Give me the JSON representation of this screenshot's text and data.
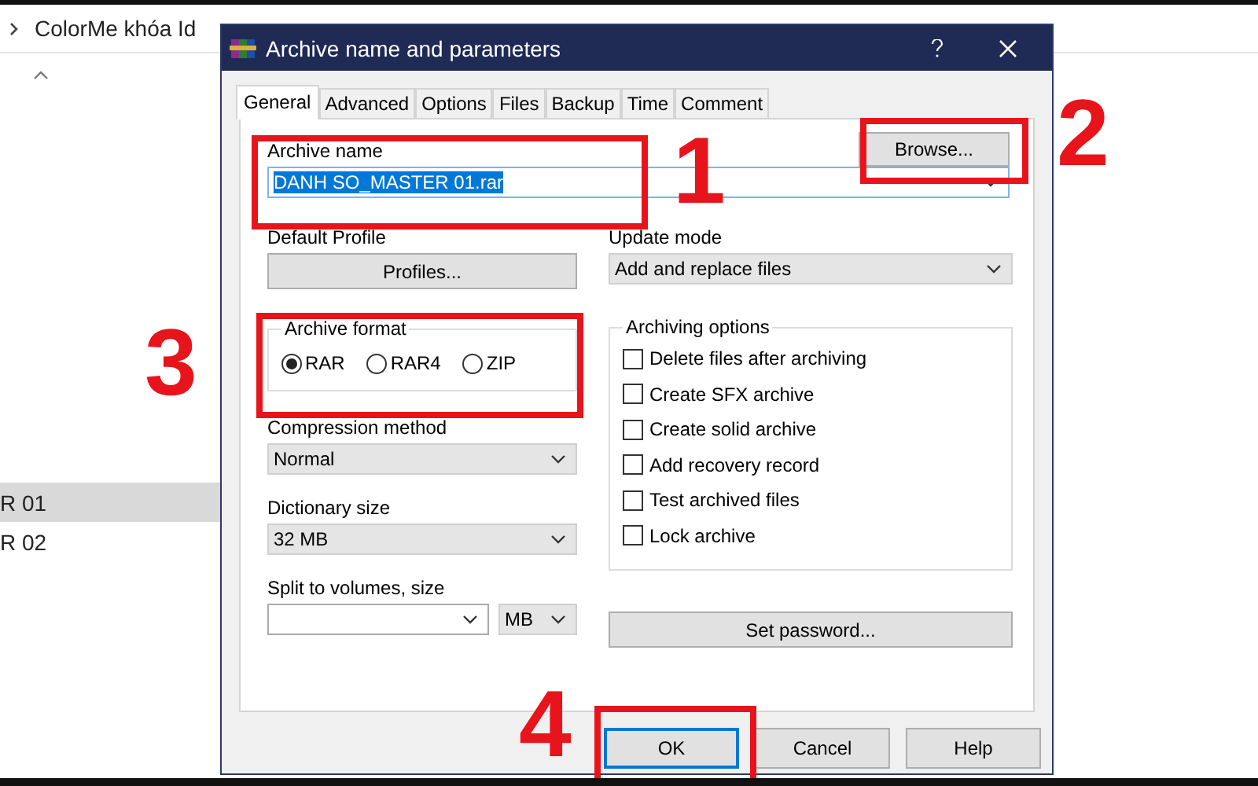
{
  "explorer": {
    "breadcrumb": "ColorMe khóa Id",
    "rows": [
      {
        "label": "R 01",
        "selected": true
      },
      {
        "label": "R 02",
        "selected": false
      }
    ]
  },
  "dialog": {
    "title": "Archive name and parameters",
    "tabs": [
      {
        "label": "General",
        "selected": true
      },
      {
        "label": "Advanced",
        "selected": false
      },
      {
        "label": "Options",
        "selected": false
      },
      {
        "label": "Files",
        "selected": false
      },
      {
        "label": "Backup",
        "selected": false
      },
      {
        "label": "Time",
        "selected": false
      },
      {
        "label": "Comment",
        "selected": false
      }
    ],
    "archive_name": {
      "label": "Archive name",
      "value": "DANH SO_MASTER 01.rar",
      "text_selected": true
    },
    "browse_button": "Browse...",
    "default_profile": {
      "label": "Default Profile",
      "button": "Profiles..."
    },
    "update_mode": {
      "label": "Update mode",
      "value": "Add and replace files"
    },
    "archive_format": {
      "label": "Archive format",
      "options": [
        {
          "label": "RAR",
          "selected": true
        },
        {
          "label": "RAR4",
          "selected": false
        },
        {
          "label": "ZIP",
          "selected": false
        }
      ]
    },
    "compression_method": {
      "label": "Compression method",
      "value": "Normal"
    },
    "dictionary_size": {
      "label": "Dictionary size",
      "value": "32 MB"
    },
    "split_volumes": {
      "label": "Split to volumes, size",
      "unit": "MB"
    },
    "archiving_options": {
      "label": "Archiving options",
      "items": [
        {
          "label": "Delete files after archiving",
          "checked": false
        },
        {
          "label": "Create SFX archive",
          "checked": false
        },
        {
          "label": "Create solid archive",
          "checked": false
        },
        {
          "label": "Add recovery record",
          "checked": false
        },
        {
          "label": "Test archived files",
          "checked": false
        },
        {
          "label": "Lock archive",
          "checked": false
        }
      ]
    },
    "set_password": "Set password...",
    "buttons": [
      {
        "label": "OK",
        "focused": true
      },
      {
        "label": "Cancel",
        "focused": false
      },
      {
        "label": "Help",
        "focused": false
      }
    ]
  },
  "annotations": [
    {
      "number": "1"
    },
    {
      "number": "2"
    },
    {
      "number": "3"
    },
    {
      "number": "4"
    }
  ]
}
